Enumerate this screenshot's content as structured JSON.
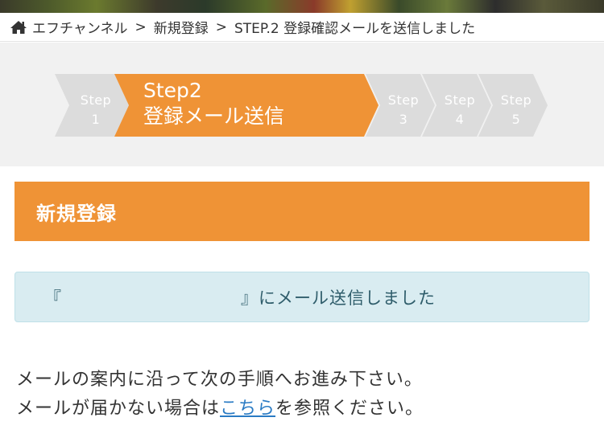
{
  "breadcrumb": {
    "home_icon": "home-icon",
    "items": [
      "エフチャンネル",
      "新規登録",
      "STEP.2 登録確認メールを送信しました"
    ],
    "separator": ">"
  },
  "steps": {
    "current": 2,
    "items": [
      {
        "label": "Step",
        "number": "1"
      },
      {
        "label": "Step2",
        "title": "登録メール送信"
      },
      {
        "label": "Step",
        "number": "3"
      },
      {
        "label": "Step",
        "number": "4"
      },
      {
        "label": "Step",
        "number": "5"
      }
    ],
    "colors": {
      "active": "#ef9336",
      "inactive": "#dcdcdc"
    }
  },
  "title_bar": {
    "text": "新規登録"
  },
  "info_box": {
    "prefix": "『",
    "email": "",
    "suffix": "』にメール送信しました"
  },
  "instructions": {
    "line1": "メールの案内に沿って次の手順へお進み下さい。",
    "line2_before": "メールが届かない場合は",
    "line2_link": "こちら",
    "line2_after": "を参照ください。"
  }
}
